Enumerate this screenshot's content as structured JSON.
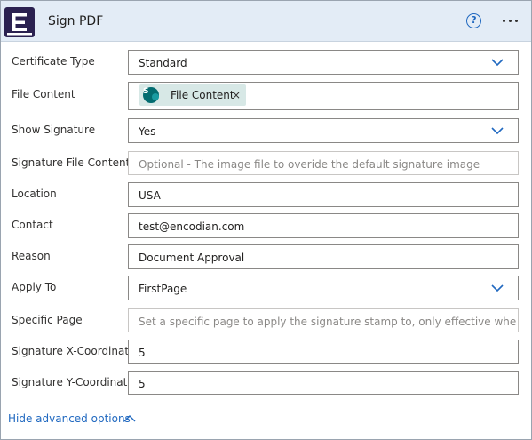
{
  "header": {
    "title": "Sign PDF",
    "help_glyph": "?",
    "logo_icon": "encodian-logo-icon",
    "help_icon": "help-circle-icon",
    "more_icon": "more-options-icon"
  },
  "fields": [
    {
      "label": "Certificate Type",
      "value": "Standard",
      "kind": "dropdown"
    },
    {
      "label": "File Content",
      "kind": "token",
      "token": {
        "label": "File Content",
        "remove": "×",
        "icon": "sharepoint-icon"
      }
    },
    {
      "label": "Show Signature",
      "value": "Yes",
      "kind": "dropdown"
    },
    {
      "label": "Signature File Content",
      "placeholder": "Optional - The image file to overide the default signature image",
      "kind": "text"
    },
    {
      "label": "Location",
      "value": "USA",
      "kind": "text"
    },
    {
      "label": "Contact",
      "value": "test@encodian.com",
      "kind": "text"
    },
    {
      "label": "Reason",
      "value": "Document Approval",
      "kind": "text"
    },
    {
      "label": "Apply To",
      "value": "FirstPage",
      "kind": "dropdown"
    },
    {
      "label": "Specific Page",
      "placeholder": "Set a specific page to apply the signature stamp to, only effective when the 'Apply To' property is set to 'SpecificPage'",
      "kind": "text"
    },
    {
      "label": "Signature X-Coordinate",
      "value": "5",
      "kind": "text"
    },
    {
      "label": "Signature Y-Coordinate",
      "value": "5",
      "kind": "text"
    }
  ],
  "footer": {
    "toggle_label": "Hide advanced options",
    "toggle_icon": "chevron-up-icon"
  },
  "colors": {
    "header_bg": "#e3ecf6",
    "accent": "#2169c0",
    "logo_bg": "#2b2150",
    "token_bg": "#d7e8e6"
  }
}
